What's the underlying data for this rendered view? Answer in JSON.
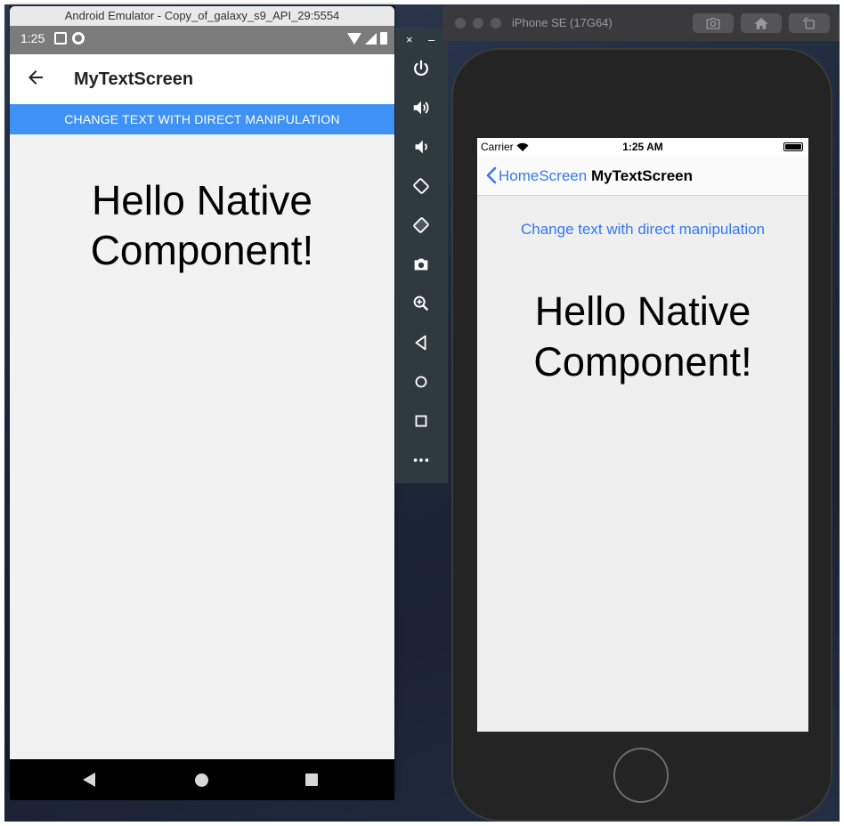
{
  "android": {
    "window_title": "Android Emulator - Copy_of_galaxy_s9_API_29:5554",
    "status_time": "1:25",
    "app_title": "MyTextScreen",
    "button_label": "CHANGE TEXT WITH DIRECT MANIPULATION",
    "hello_line1": "Hello Native",
    "hello_line2": "Component!"
  },
  "emulator_toolbar": {
    "close_label": "×",
    "minimize_label": "–",
    "items": [
      "power-icon",
      "volume-up-icon",
      "volume-down-icon",
      "rotate-left-icon",
      "rotate-right-icon",
      "camera-icon",
      "zoom-icon",
      "back-icon",
      "home-icon",
      "overview-icon",
      "more-icon"
    ]
  },
  "ios": {
    "window_title": "iPhone SE (17G64)",
    "carrier": "Carrier",
    "time": "1:25 AM",
    "back_label": "HomeScreen",
    "nav_title": "MyTextScreen",
    "link_text": "Change text with direct manipulation",
    "hello_line1": "Hello Native",
    "hello_line2": "Component!"
  },
  "colors": {
    "android_accent": "#3f92f5",
    "ios_tint": "#3478f6",
    "content_bg": "#f2f2f2"
  }
}
